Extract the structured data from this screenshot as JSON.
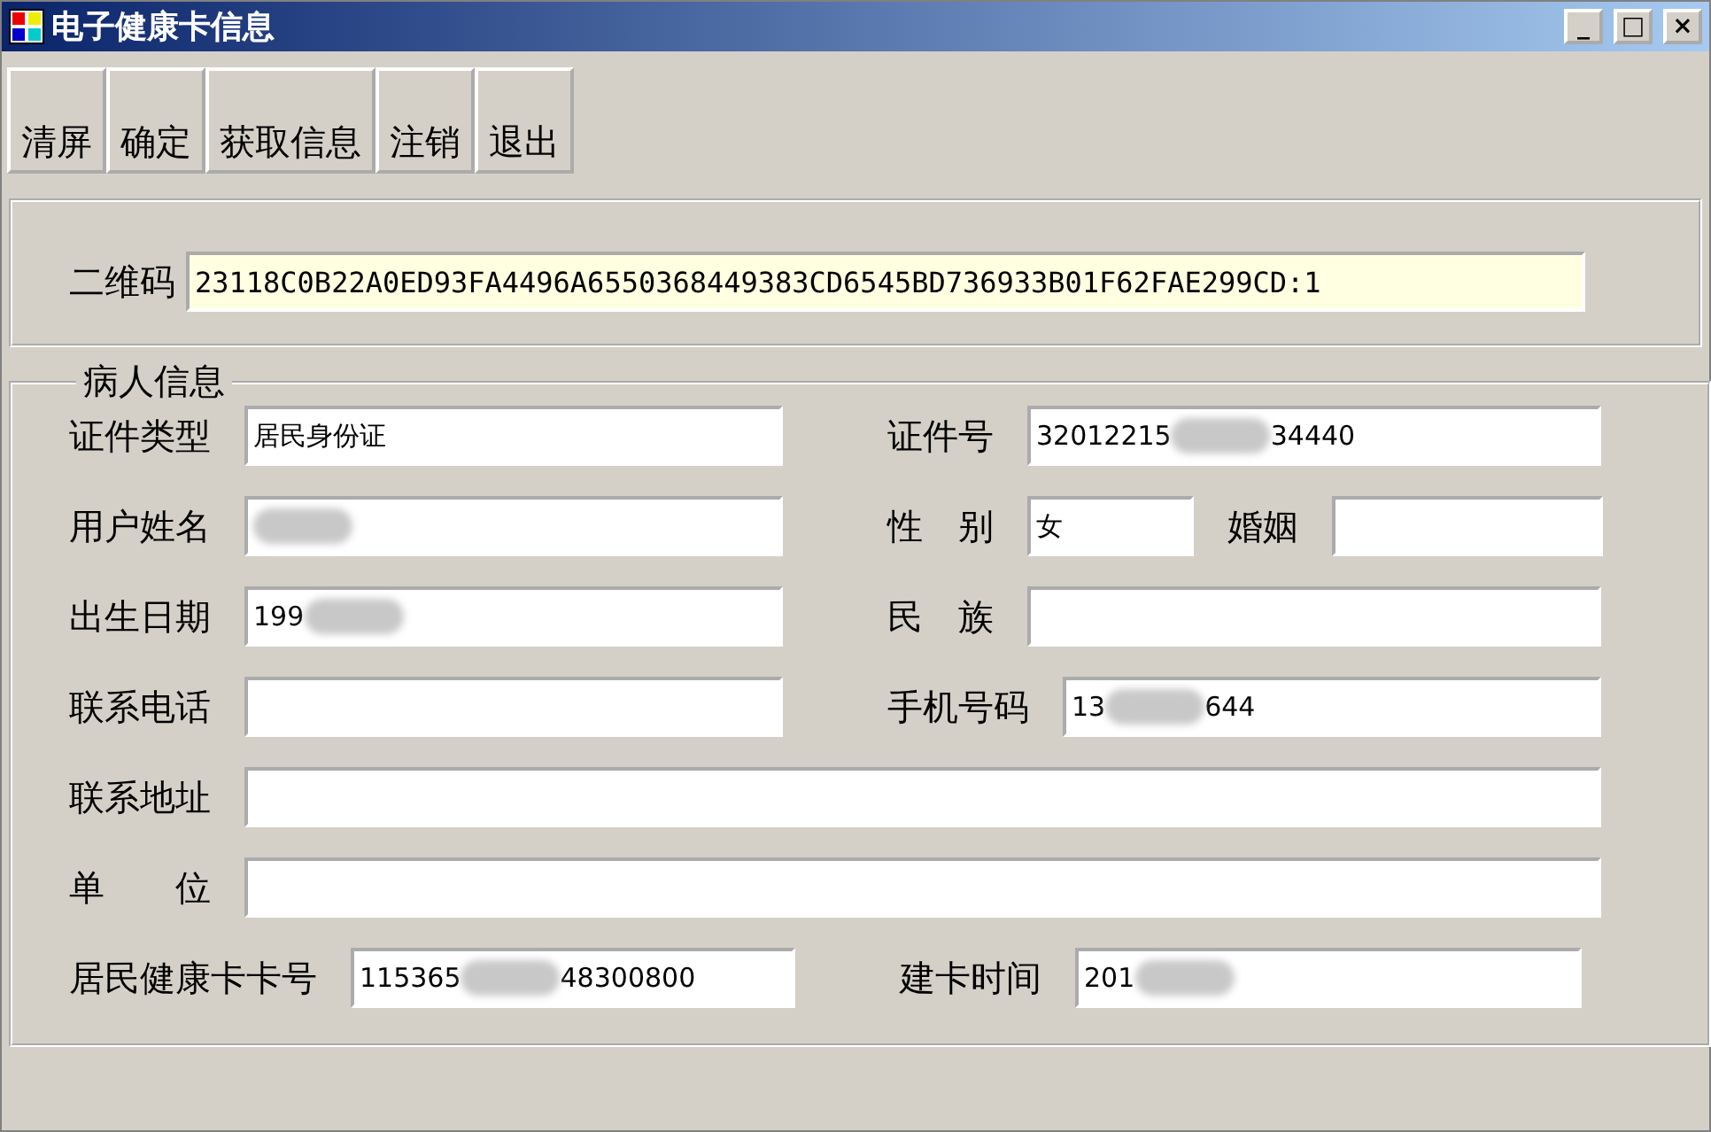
{
  "window": {
    "title": "电子健康卡信息",
    "controls": [
      "_",
      "□",
      "×"
    ]
  },
  "toolbar": [
    "清屏",
    "确定",
    "获取信息",
    "注销",
    "退出"
  ],
  "qr": {
    "label": "二维码",
    "value": "23118C0B22A0ED93FA4496A6550368449383CD6545BD736933B01F62FAE299CD:1"
  },
  "patient": {
    "title": "病人信息",
    "rows": [
      {
        "kind": "two",
        "fields": [
          {
            "label": "证件类型",
            "value": "居民身份证",
            "redacted": false
          },
          {
            "label": "证件号",
            "value": "32012215",
            "value_end": "34440",
            "redacted": true
          }
        ]
      },
      {
        "kind": "three",
        "fields": [
          {
            "label": "用户姓名",
            "redacted": true
          },
          {
            "label": "性　别",
            "value": "女",
            "redacted": false
          },
          {
            "label": "婚姻",
            "redacted": false
          }
        ]
      },
      {
        "kind": "two",
        "fields": [
          {
            "label": "出生日期",
            "value": "199",
            "redacted": true
          },
          {
            "label": "民　族",
            "redacted": false
          }
        ]
      },
      {
        "kind": "two",
        "fields": [
          {
            "label": "联系电话",
            "redacted": false
          },
          {
            "label": "手机号码",
            "value": "13",
            "value_end": "644",
            "redacted": true
          }
        ]
      },
      {
        "kind": "wide",
        "fields": [
          {
            "label": "联系地址",
            "redacted": false
          }
        ]
      },
      {
        "kind": "wide",
        "fields": [
          {
            "label": "单　　位",
            "redacted": false
          }
        ]
      },
      {
        "kind": "two",
        "fields": [
          {
            "label": "居民健康卡卡号",
            "value": "115365",
            "value_end": "48300800",
            "redacted": true
          },
          {
            "label": "建卡时间",
            "value": "201",
            "redacted": true
          }
        ]
      }
    ]
  }
}
